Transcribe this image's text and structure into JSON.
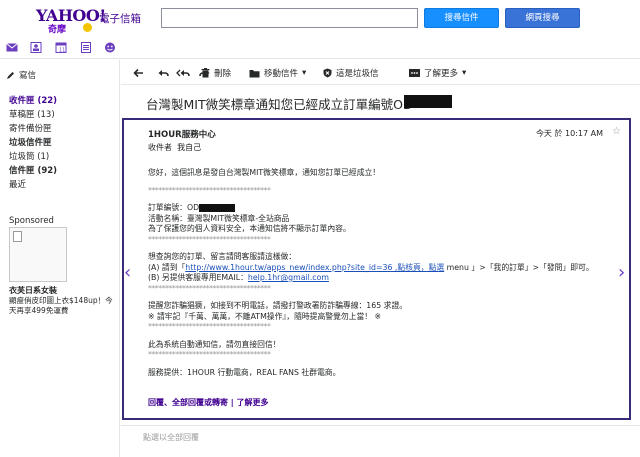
{
  "brand": {
    "yahoo": "YAHOO!",
    "qimo": "奇摩",
    "app_title": "電子信箱"
  },
  "search": {
    "query": "",
    "mail_search_label": "搜尋信件",
    "web_search_label": "網頁搜尋"
  },
  "colors": {
    "brand_purple": "#400090",
    "search_blue": "#188fff",
    "web_blue": "#3a73d8",
    "card_border": "#3a2a7a"
  },
  "top_icons": [
    "mail-icon",
    "contacts-icon",
    "calendar-icon",
    "notepad-icon",
    "messenger-icon"
  ],
  "sidebar": {
    "compose_label": "寫信",
    "folders": [
      {
        "label": "收件匣 (22)",
        "style": "inbox"
      },
      {
        "label": "草稿匣 (13)",
        "style": "normal"
      },
      {
        "label": "寄件備份匣",
        "style": "normal"
      },
      {
        "label": "垃圾信件匣",
        "style": "bold"
      },
      {
        "label": "垃圾筒 (1)",
        "style": "normal"
      },
      {
        "label": "信件匣 (92)",
        "style": "bold"
      },
      {
        "label": "最近",
        "style": "normal"
      }
    ],
    "sponsored_label": "Sponsored",
    "ad_title": "衣芙日系女裝",
    "ad_text": "顯瘦俏皮印圖上衣$148up！今天再享499免運費"
  },
  "toolbar": {
    "back_icon": "arrow-left-icon",
    "reply_icon": "reply-icon",
    "reply_all_icon": "reply-all-icon",
    "forward_icon": "forward-icon",
    "delete_label": "刪除",
    "move_label": "移動信件",
    "spam_label": "這是垃圾信",
    "more_label": "了解更多"
  },
  "message": {
    "subject": "台灣製MIT微笑標章通知您已經成立訂單編號OD",
    "sender": "1HOUR服務中心",
    "recipient_label": "收件者",
    "recipient": "我自己",
    "date": "今天 於 10:17 AM",
    "lines": {
      "greeting": "您好，這個訊息是發自台灣製MIT微笑標章，通知您訂單已經成立！",
      "sep1": "************************************",
      "order_no_label": "訂單編號：OD",
      "activity": "活動名稱：臺灣製MIT微笑標章-全站商品",
      "privacy": "為了保護您的個人資料安全，本通知信將不顯示訂單內容。",
      "sep2": "************************************",
      "query_intro": "想查詢您的訂單、留言請問客服請這樣做：",
      "query_a_prefix": "(A) 請到「",
      "query_a_link": "http://www.1hour.tw/apps_new/index.php?site_id=36 ,點核頁，點選",
      "query_a_suffix": " menu 」>「我的訂單」>「發問」即可。",
      "query_b_prefix": "(B) 另提供客服專用EMAIL：",
      "query_b_link": "help.1hr@gmail.com",
      "sep3": "************************************",
      "fraud_warning": "提醒您詐騙猖獗，如接到不明電話，請撥打警政署防詐騙專線：165 求證。",
      "fraud_note": "※ 請牢記『千萬、萬萬，不離ATM操作』，隨時提高警覺勿上當！ ※",
      "sep4": "************************************",
      "auto_notice": "此為系統自動通知信，請勿直接回信！",
      "sep5": "************************************",
      "provider": "服務提供：1HOUR 行動電商，REAL FANS 社群電商。"
    },
    "actions": {
      "reply": "回覆",
      "sep1": "、",
      "reply_all": "全部回覆",
      "or": "或",
      "forward": "轉寄",
      "sep2": " | ",
      "more": "了解更多"
    }
  },
  "reply_placeholder": "點選以全部回覆"
}
